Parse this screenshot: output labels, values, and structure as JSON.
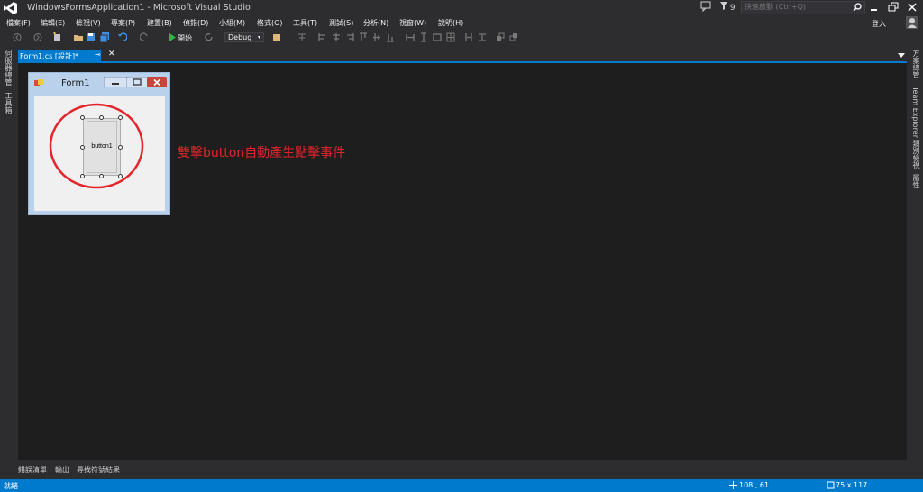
{
  "window": {
    "title": "WindowsFormsApplication1 - Microsoft Visual Studio",
    "notification_count": "9",
    "quick_launch_placeholder": "快速啟動 (Ctrl+Q)"
  },
  "menu": {
    "items": [
      "檔案(F)",
      "編輯(E)",
      "檢視(V)",
      "專案(P)",
      "建置(B)",
      "偵錯(D)",
      "小組(M)",
      "格式(O)",
      "工具(T)",
      "測試(S)",
      "分析(N)",
      "視窗(W)",
      "說明(H)"
    ],
    "login": "登入"
  },
  "toolbar": {
    "start_label": "開始",
    "config_value": "Debug"
  },
  "side_left": {
    "tabs": [
      "伺服器總管",
      "工具箱"
    ]
  },
  "side_right": {
    "tabs": [
      "方案總管",
      "Team Explorer",
      "類別檢視",
      "屬性"
    ]
  },
  "document_tab": {
    "label": "Form1.cs [設計]*"
  },
  "designer": {
    "form_title": "Form1",
    "button_text": "button1",
    "annotation": "雙擊button自動產生點擊事件",
    "annotation_color": "#e3242b"
  },
  "bottom_tabs": [
    "錯誤清單",
    "輸出",
    "尋找符號結果"
  ],
  "status": {
    "text": "就緒",
    "position": "108 , 61",
    "size": "75 x 117",
    "accent": "#007acc"
  }
}
